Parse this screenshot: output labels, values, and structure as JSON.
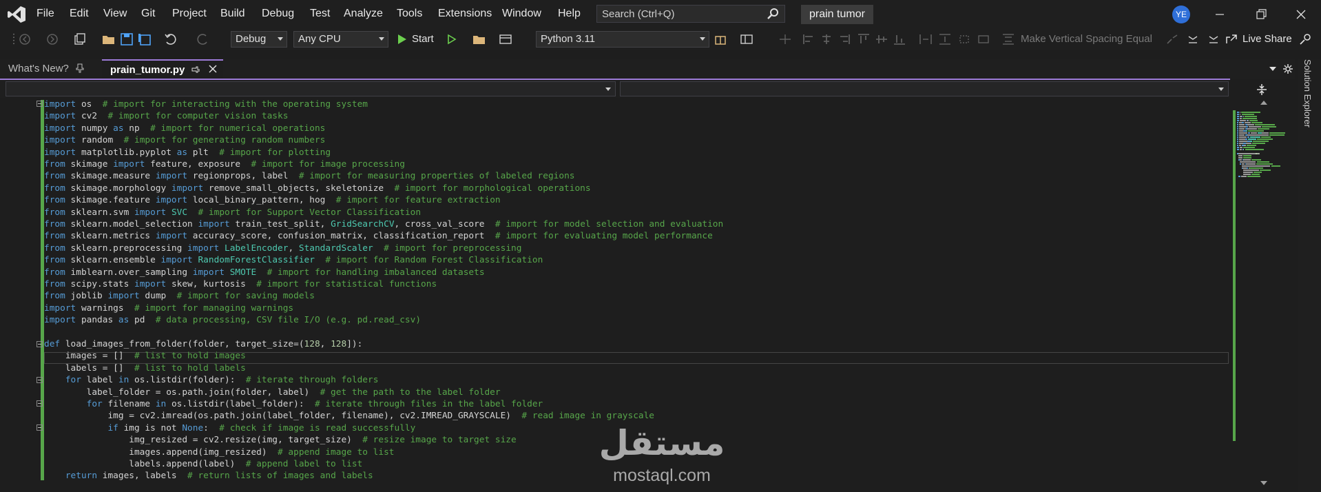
{
  "menu": {
    "items": [
      "File",
      "Edit",
      "View",
      "Git",
      "Project",
      "Build",
      "Debug",
      "Test",
      "Analyze",
      "Tools",
      "Extensions",
      "Window",
      "Help"
    ],
    "search_placeholder": "Search (Ctrl+Q)",
    "project_name": "prain tumor",
    "user_initials": "YE"
  },
  "toolbar": {
    "configuration": "Debug",
    "platform": "Any CPU",
    "start_label": "Start",
    "python_env": "Python 3.11",
    "vertical_spacing_label": "Make Vertical Spacing Equal",
    "live_share_label": "Live Share"
  },
  "tabs": [
    {
      "label": "What's New?",
      "active": false
    },
    {
      "label": "prain_tumor.py",
      "active": true
    }
  ],
  "side_panel": {
    "label": "Solution Explorer"
  },
  "watermark": {
    "arabic": "مستقل",
    "latin": "mostaql.com"
  },
  "colors": {
    "keyword": "#569cd6",
    "class": "#4ec9b0",
    "comment": "#57a64a",
    "number": "#b5cea8",
    "text": "#d4d4d4",
    "tab_accent": "#9d7bd8"
  },
  "code_lines": [
    [
      [
        "kw",
        "import"
      ],
      [
        "tx",
        " os  "
      ],
      [
        "cm",
        "# import for interacting with the operating system"
      ]
    ],
    [
      [
        "kw",
        "import"
      ],
      [
        "tx",
        " cv2  "
      ],
      [
        "cm",
        "# import for computer vision tasks"
      ]
    ],
    [
      [
        "kw",
        "import"
      ],
      [
        "tx",
        " numpy "
      ],
      [
        "kw",
        "as"
      ],
      [
        "tx",
        " np  "
      ],
      [
        "cm",
        "# import for numerical operations"
      ]
    ],
    [
      [
        "kw",
        "import"
      ],
      [
        "tx",
        " random  "
      ],
      [
        "cm",
        "# import for generating random numbers"
      ]
    ],
    [
      [
        "kw",
        "import"
      ],
      [
        "tx",
        " matplotlib.pyplot "
      ],
      [
        "kw",
        "as"
      ],
      [
        "tx",
        " plt  "
      ],
      [
        "cm",
        "# import for plotting"
      ]
    ],
    [
      [
        "kw",
        "from"
      ],
      [
        "tx",
        " skimage "
      ],
      [
        "kw",
        "import"
      ],
      [
        "tx",
        " feature, exposure  "
      ],
      [
        "cm",
        "# import for image processing"
      ]
    ],
    [
      [
        "kw",
        "from"
      ],
      [
        "tx",
        " skimage.measure "
      ],
      [
        "kw",
        "import"
      ],
      [
        "tx",
        " regionprops, label  "
      ],
      [
        "cm",
        "# import for measuring properties of labeled regions"
      ]
    ],
    [
      [
        "kw",
        "from"
      ],
      [
        "tx",
        " skimage.morphology "
      ],
      [
        "kw",
        "import"
      ],
      [
        "tx",
        " remove_small_objects, skeletonize  "
      ],
      [
        "cm",
        "# import for morphological operations"
      ]
    ],
    [
      [
        "kw",
        "from"
      ],
      [
        "tx",
        " skimage.feature "
      ],
      [
        "kw",
        "import"
      ],
      [
        "tx",
        " local_binary_pattern, hog  "
      ],
      [
        "cm",
        "# import for feature extraction"
      ]
    ],
    [
      [
        "kw",
        "from"
      ],
      [
        "tx",
        " sklearn.svm "
      ],
      [
        "kw",
        "import"
      ],
      [
        "tx",
        " "
      ],
      [
        "cls",
        "SVC"
      ],
      [
        "tx",
        "  "
      ],
      [
        "cm",
        "# import for Support Vector Classification"
      ]
    ],
    [
      [
        "kw",
        "from"
      ],
      [
        "tx",
        " sklearn.model_selection "
      ],
      [
        "kw",
        "import"
      ],
      [
        "tx",
        " train_test_split, "
      ],
      [
        "cls",
        "GridSearchCV"
      ],
      [
        "tx",
        ", cross_val_score  "
      ],
      [
        "cm",
        "# import for model selection and evaluation"
      ]
    ],
    [
      [
        "kw",
        "from"
      ],
      [
        "tx",
        " sklearn.metrics "
      ],
      [
        "kw",
        "import"
      ],
      [
        "tx",
        " accuracy_score, confusion_matrix, classification_report  "
      ],
      [
        "cm",
        "# import for evaluating model performance"
      ]
    ],
    [
      [
        "kw",
        "from"
      ],
      [
        "tx",
        " sklearn.preprocessing "
      ],
      [
        "kw",
        "import"
      ],
      [
        "tx",
        " "
      ],
      [
        "cls",
        "LabelEncoder"
      ],
      [
        "tx",
        ", "
      ],
      [
        "cls",
        "StandardScaler"
      ],
      [
        "tx",
        "  "
      ],
      [
        "cm",
        "# import for preprocessing"
      ]
    ],
    [
      [
        "kw",
        "from"
      ],
      [
        "tx",
        " sklearn.ensemble "
      ],
      [
        "kw",
        "import"
      ],
      [
        "tx",
        " "
      ],
      [
        "cls",
        "RandomForestClassifier"
      ],
      [
        "tx",
        "  "
      ],
      [
        "cm",
        "# import for Random Forest Classification"
      ]
    ],
    [
      [
        "kw",
        "from"
      ],
      [
        "tx",
        " imblearn.over_sampling "
      ],
      [
        "kw",
        "import"
      ],
      [
        "tx",
        " "
      ],
      [
        "cls",
        "SMOTE"
      ],
      [
        "tx",
        "  "
      ],
      [
        "cm",
        "# import for handling imbalanced datasets"
      ]
    ],
    [
      [
        "kw",
        "from"
      ],
      [
        "tx",
        " scipy.stats "
      ],
      [
        "kw",
        "import"
      ],
      [
        "tx",
        " skew, kurtosis  "
      ],
      [
        "cm",
        "# import for statistical functions"
      ]
    ],
    [
      [
        "kw",
        "from"
      ],
      [
        "tx",
        " joblib "
      ],
      [
        "kw",
        "import"
      ],
      [
        "tx",
        " dump  "
      ],
      [
        "cm",
        "# import for saving models"
      ]
    ],
    [
      [
        "kw",
        "import"
      ],
      [
        "tx",
        " warnings  "
      ],
      [
        "cm",
        "# import for managing warnings"
      ]
    ],
    [
      [
        "kw",
        "import"
      ],
      [
        "tx",
        " pandas "
      ],
      [
        "kw",
        "as"
      ],
      [
        "tx",
        " pd  "
      ],
      [
        "cm",
        "# data processing, CSV file I/O (e.g. pd.read_csv)"
      ]
    ],
    [],
    [
      [
        "kw",
        "def"
      ],
      [
        "tx",
        " load_images_from_folder(folder, target_size=("
      ],
      [
        "num",
        "128"
      ],
      [
        "tx",
        ", "
      ],
      [
        "num",
        "128"
      ],
      [
        "tx",
        "]):"
      ]
    ],
    [
      [
        "tx",
        "    images = []  "
      ],
      [
        "cm",
        "# list to hold images"
      ]
    ],
    [
      [
        "tx",
        "    labels = []  "
      ],
      [
        "cm",
        "# list to hold labels"
      ]
    ],
    [
      [
        "tx",
        "    "
      ],
      [
        "kw",
        "for"
      ],
      [
        "tx",
        " label "
      ],
      [
        "kw",
        "in"
      ],
      [
        "tx",
        " os.listdir(folder):  "
      ],
      [
        "cm",
        "# iterate through folders"
      ]
    ],
    [
      [
        "tx",
        "        label_folder = os.path.join(folder, label)  "
      ],
      [
        "cm",
        "# get the path to the label folder"
      ]
    ],
    [
      [
        "tx",
        "        "
      ],
      [
        "kw",
        "for"
      ],
      [
        "tx",
        " filename "
      ],
      [
        "kw",
        "in"
      ],
      [
        "tx",
        " os.listdir(label_folder):  "
      ],
      [
        "cm",
        "# iterate through files in the label folder"
      ]
    ],
    [
      [
        "tx",
        "            img = cv2.imread(os.path.join(label_folder, filename), cv2.IMREAD_GRAYSCALE)  "
      ],
      [
        "cm",
        "# read image in grayscale"
      ]
    ],
    [
      [
        "tx",
        "            "
      ],
      [
        "kw",
        "if"
      ],
      [
        "tx",
        " img is not "
      ],
      [
        "kw",
        "None"
      ],
      [
        "tx",
        ":  "
      ],
      [
        "cm",
        "# check if image is read successfully"
      ]
    ],
    [
      [
        "tx",
        "                img_resized = cv2.resize(img, target_size)  "
      ],
      [
        "cm",
        "# resize image to target size"
      ]
    ],
    [
      [
        "tx",
        "                images.append(img_resized)  "
      ],
      [
        "cm",
        "# append image to list"
      ]
    ],
    [
      [
        "tx",
        "                labels.append(label)  "
      ],
      [
        "cm",
        "# append label to list"
      ]
    ],
    [
      [
        "tx",
        "    "
      ],
      [
        "kw",
        "return"
      ],
      [
        "tx",
        " images, labels  "
      ],
      [
        "cm",
        "# return lists of images and labels"
      ]
    ]
  ]
}
